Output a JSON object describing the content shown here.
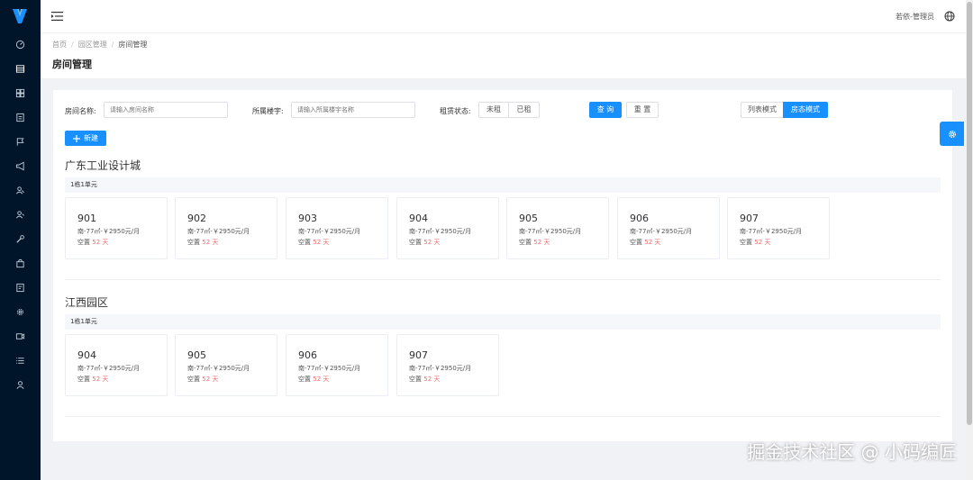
{
  "header": {
    "user": "若依-管理员"
  },
  "breadcrumb": {
    "home": "首页",
    "parent": "园区管理",
    "current": "房间管理"
  },
  "page_title": "房间管理",
  "filters": {
    "room_name_label": "房间名称:",
    "room_name_placeholder": "请输入房间名称",
    "building_label": "所属楼宇:",
    "building_placeholder": "请输入所属楼宇名称",
    "rent_status_label": "租赁状态:",
    "status_options": [
      "未租",
      "已租"
    ],
    "search_label": "查 询",
    "reset_label": "重 置",
    "view_list_label": "列表模式",
    "view_status_label": "房态模式"
  },
  "new_button": "新建",
  "parks": [
    {
      "name": "广东工业设计城",
      "unit": "1栋1单元",
      "rooms": [
        {
          "no": "901",
          "info": "南-77㎡-￥2950元/月",
          "vacant_prefix": "空置 ",
          "days": "52 天"
        },
        {
          "no": "902",
          "info": "南-77㎡-￥2950元/月",
          "vacant_prefix": "空置 ",
          "days": "52 天"
        },
        {
          "no": "903",
          "info": "南-77㎡-￥2950元/月",
          "vacant_prefix": "空置 ",
          "days": "52 天"
        },
        {
          "no": "904",
          "info": "南-77㎡-￥2950元/月",
          "vacant_prefix": "空置 ",
          "days": "52 天"
        },
        {
          "no": "905",
          "info": "南-77㎡-￥2950元/月",
          "vacant_prefix": "空置 ",
          "days": "52 天"
        },
        {
          "no": "906",
          "info": "南-77㎡-￥2950元/月",
          "vacant_prefix": "空置 ",
          "days": "52 天"
        },
        {
          "no": "907",
          "info": "南-77㎡-￥2950元/月",
          "vacant_prefix": "空置 ",
          "days": "52 天"
        }
      ]
    },
    {
      "name": "江西园区",
      "unit": "1栋1单元",
      "rooms": [
        {
          "no": "904",
          "info": "南-77㎡-￥2950元/月",
          "vacant_prefix": "空置 ",
          "days": "52 天"
        },
        {
          "no": "905",
          "info": "南-77㎡-￥2950元/月",
          "vacant_prefix": "空置 ",
          "days": "52 天"
        },
        {
          "no": "906",
          "info": "南-77㎡-￥2950元/月",
          "vacant_prefix": "空置 ",
          "days": "52 天"
        },
        {
          "no": "907",
          "info": "南-77㎡-￥2950元/月",
          "vacant_prefix": "空置 ",
          "days": "52 天"
        }
      ]
    }
  ],
  "sidebar_icons": [
    "dashboard-icon",
    "building-icon",
    "grid-icon",
    "document-icon",
    "flag-icon",
    "megaphone-icon",
    "users-icon",
    "user-group-icon",
    "wrench-icon",
    "bag-icon",
    "report-icon",
    "settings-icon",
    "video-icon",
    "list-icon",
    "user-icon"
  ],
  "watermark": "掘金技术社区 @ 小码编匠",
  "colors": {
    "primary": "#1890ff",
    "sidebar": "#001529",
    "danger": "#f56c6c"
  }
}
